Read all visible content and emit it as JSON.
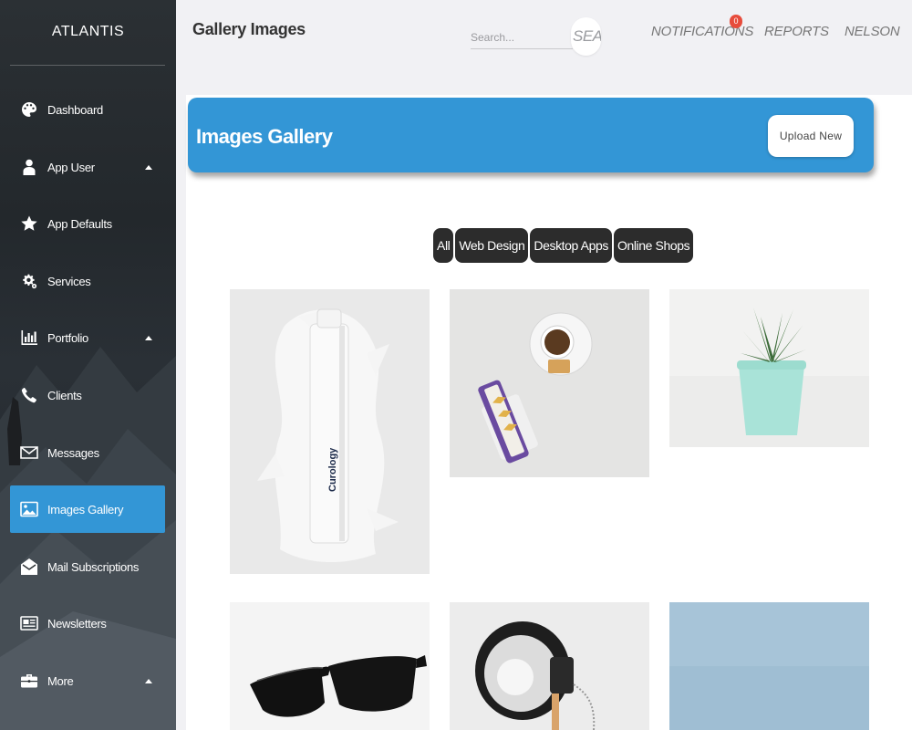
{
  "sidebar": {
    "brand": "ATLANTIS",
    "items": [
      {
        "label": "Dashboard"
      },
      {
        "label": "App User"
      },
      {
        "label": "App Defaults"
      },
      {
        "label": "Services"
      },
      {
        "label": "Portfolio"
      },
      {
        "label": "Clients"
      },
      {
        "label": "Messages"
      },
      {
        "label": "Images Gallery"
      },
      {
        "label": "Mail Subscriptions"
      },
      {
        "label": "Newsletters"
      },
      {
        "label": "More"
      }
    ],
    "active_color": "#3396d6"
  },
  "topbar": {
    "page_title": "Gallery Images",
    "search_placeholder": "Search...",
    "search_button": "SEARCH",
    "notifications_label": "NOTIFICATIONS",
    "notifications_count": "0",
    "reports_label": "REPORTS",
    "user_label": "NELSON"
  },
  "gallery": {
    "header_title": "Images Gallery",
    "upload_label": "Upload New",
    "filters": [
      "All",
      "Web Design",
      "Desktop Apps",
      "Online Shops"
    ],
    "tiles": [
      {
        "subject": "cosmetic bottle in cream splash",
        "bottle_text": "Curology"
      },
      {
        "subject": "coffee cup with biscuits"
      },
      {
        "subject": "succulent in mint pot"
      },
      {
        "subject": "black sunglasses"
      },
      {
        "subject": "desk lamp"
      },
      {
        "subject": "light blue backdrop"
      }
    ]
  },
  "colors": {
    "accent": "#3396d6",
    "filter_bg": "#2c2c2c",
    "badge": "#e74c3c"
  }
}
